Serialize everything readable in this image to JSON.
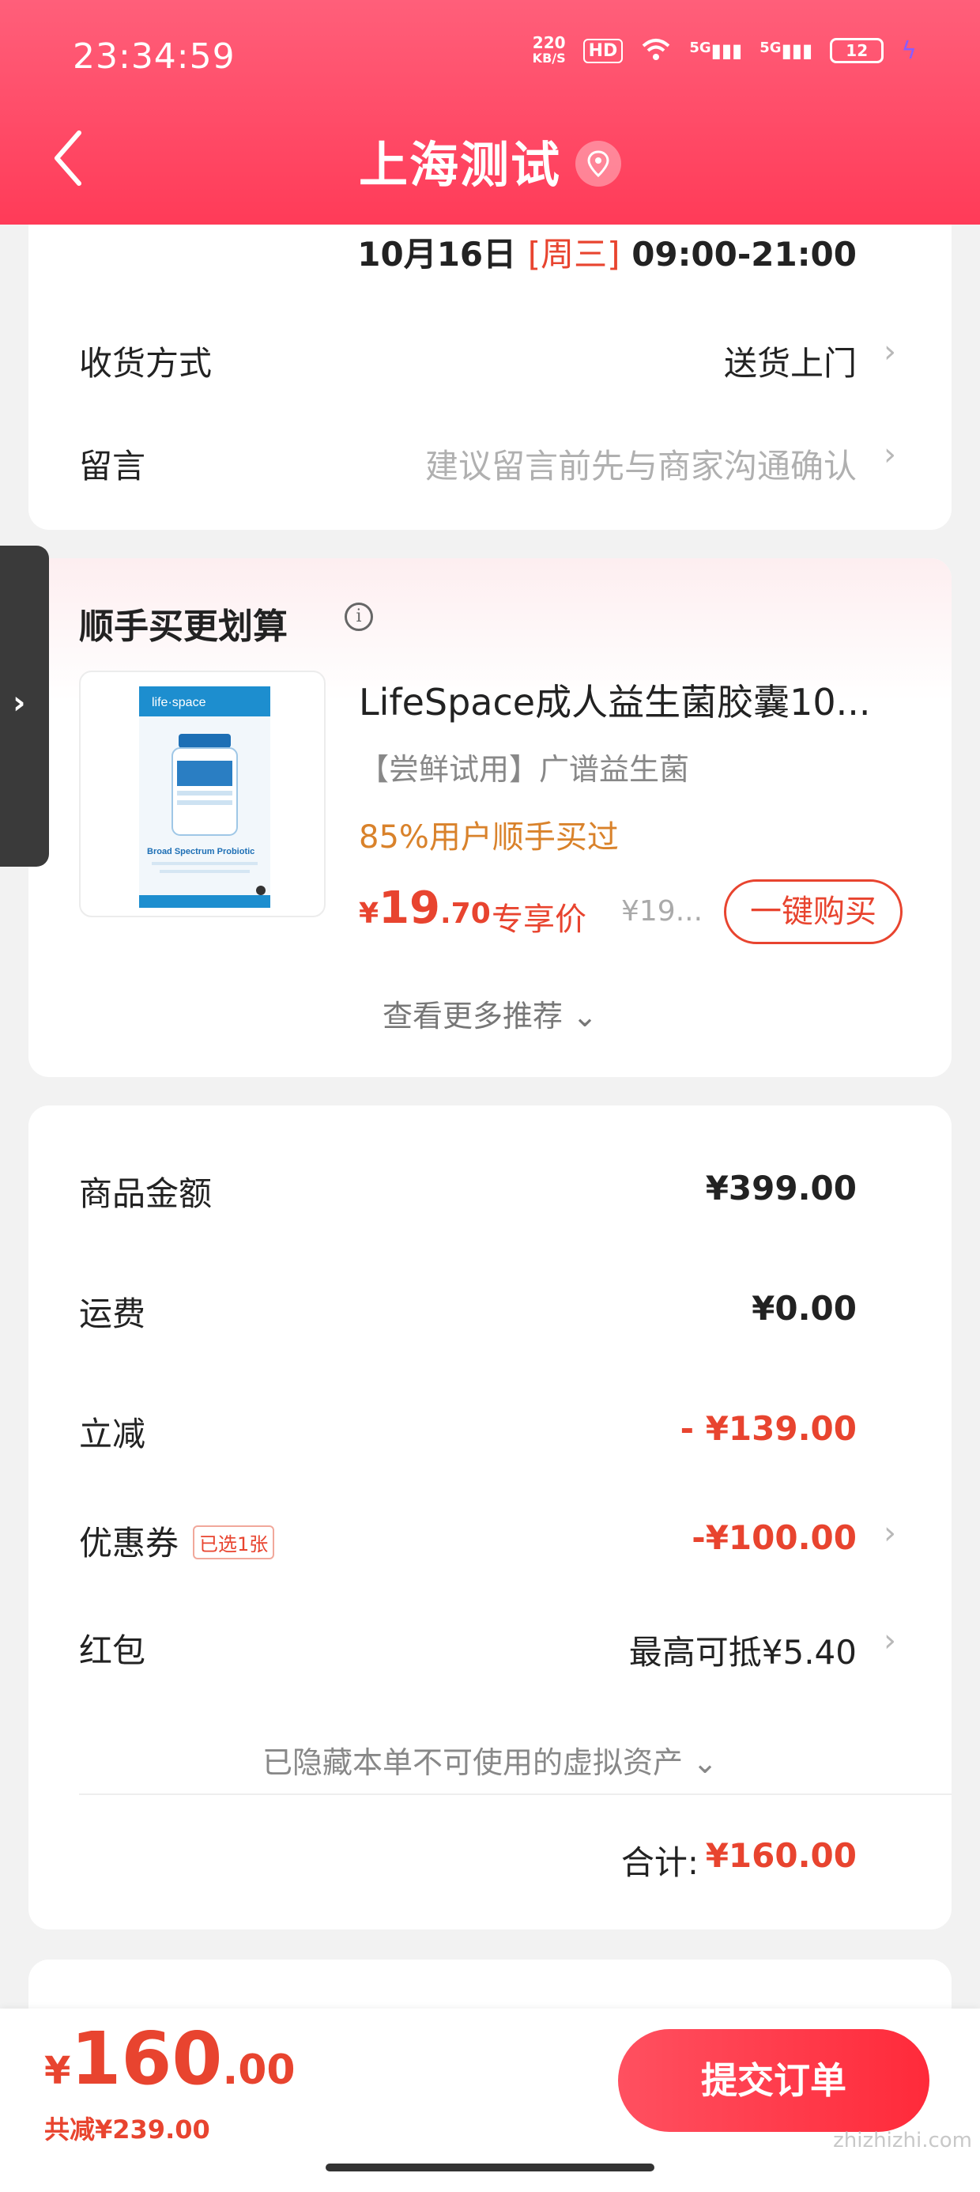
{
  "status_bar": {
    "time": "23:34:59",
    "net_speed_top": "220",
    "net_speed_bottom": "KB/S",
    "hd": "HD",
    "sig1": "5G",
    "sig2": "5G",
    "battery": "12"
  },
  "header": {
    "title": "上海测试"
  },
  "delivery": {
    "date": "10月16日",
    "weekday": "[周三]",
    "hours": "09:00-21:00",
    "method_label": "收货方式",
    "method_value": "送货上门",
    "message_label": "留言",
    "message_placeholder": "建议留言前先与商家沟通确认"
  },
  "recommend": {
    "title": "顺手买更划算",
    "product": {
      "name": "LifeSpace成人益生菌胶囊10...",
      "desc": "【尝鲜试用】广谱益生菌",
      "pct": "85%用户顺手买过",
      "price_yen": "¥",
      "price_int": "19",
      "price_dec": ".70",
      "price_tag": "专享价",
      "orig_price": "¥19...",
      "buy_label": "一键购买",
      "image_brand": "life·space",
      "image_label": "Broad Spectrum Probiotic"
    },
    "more": "查看更多推荐 ⌄"
  },
  "summary": {
    "goods_label": "商品金额",
    "goods_value": "¥399.00",
    "shipping_label": "运费",
    "shipping_value": "¥0.00",
    "discount_label": "立减",
    "discount_value": "- ¥139.00",
    "coupon_label": "优惠券",
    "coupon_badge": "已选1张",
    "coupon_value": "-¥100.00",
    "redpacket_label": "红包",
    "redpacket_value": "最高可抵¥5.40",
    "hidden_assets": "已隐藏本单不可使用的虚拟资产 ⌄",
    "total_label": "合计:",
    "total_value": "¥160.00"
  },
  "bottom_bar": {
    "yen": "¥",
    "int": "160",
    "dec": ".00",
    "saved": "共减¥239.00",
    "submit": "提交订单",
    "watermark": "zhizhizhi.com"
  },
  "colors": {
    "header_start": "#ff5f7a",
    "header_end": "#ff3b58",
    "accent": "#e8442f",
    "orange": "#d9822b"
  }
}
